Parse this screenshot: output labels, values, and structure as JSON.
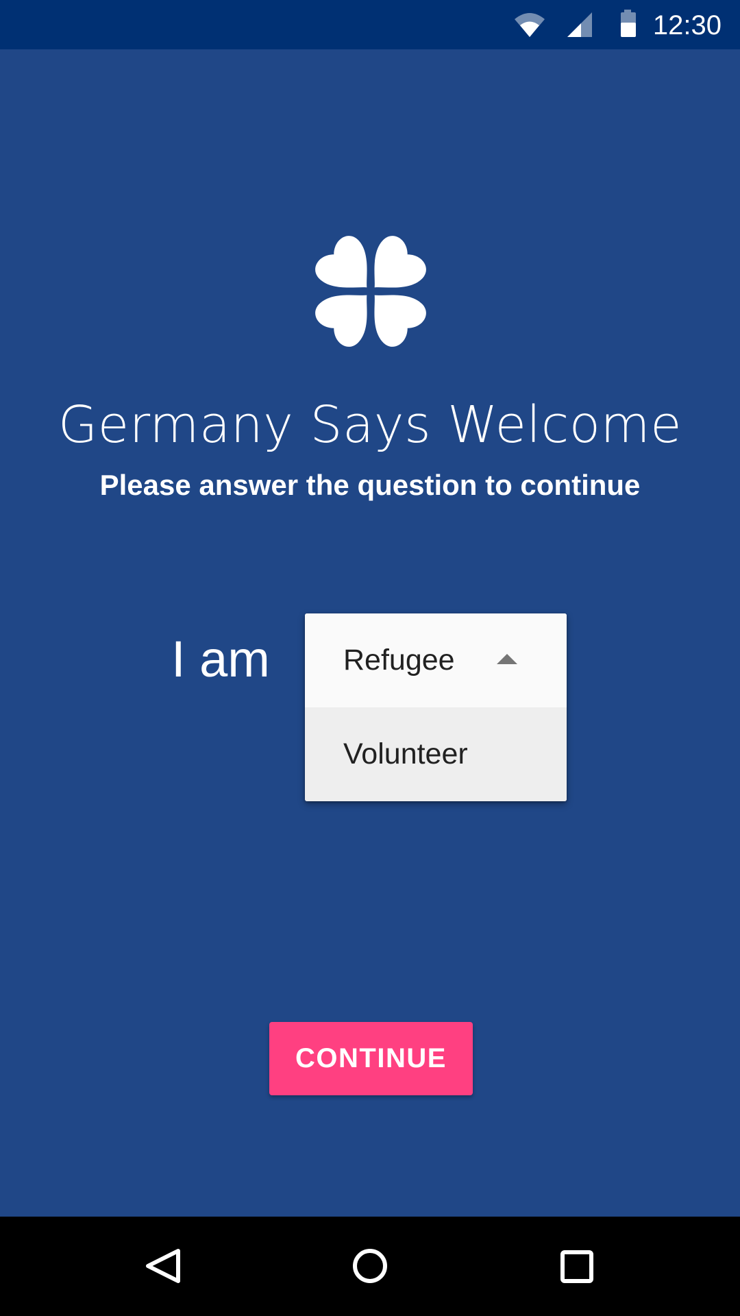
{
  "status_bar": {
    "time": "12:30",
    "icons": [
      "wifi-icon",
      "cell-signal-icon",
      "battery-icon"
    ]
  },
  "app": {
    "logo": "clover-logo-icon",
    "title": "Germany Says Welcome",
    "subtitle": "Please answer the question to continue"
  },
  "question": {
    "label": "I am",
    "dropdown": {
      "selected": "Refugee",
      "options": [
        "Refugee",
        "Volunteer"
      ],
      "expanded": true
    }
  },
  "actions": {
    "continue_label": "CONTINUE"
  },
  "nav_bar": {
    "buttons": [
      "back-icon",
      "home-icon",
      "recents-icon"
    ]
  },
  "colors": {
    "background": "#204787",
    "status_bar": "#003073",
    "accent": "#ff4081",
    "dropdown_selected_bg": "#fafafa",
    "dropdown_option_bg": "#eeeeee"
  }
}
